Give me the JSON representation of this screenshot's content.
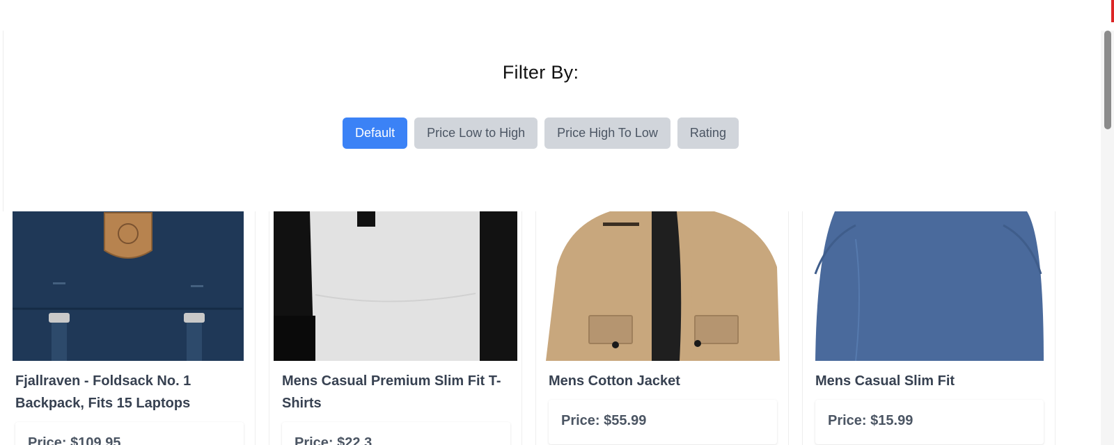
{
  "filter": {
    "title": "Filter By:",
    "options": [
      "Default",
      "Price Low to High",
      "Price High To Low",
      "Rating"
    ],
    "active": "Default"
  },
  "products": [
    {
      "title": "Fjallraven - Foldsack No. 1 Backpack, Fits 15 Laptops",
      "price_label": "Price: $109.95"
    },
    {
      "title": "Mens Casual Premium Slim Fit T-Shirts",
      "price_label": "Price: $22.3"
    },
    {
      "title": "Mens Cotton Jacket",
      "price_label": "Price: $55.99"
    },
    {
      "title": "Mens Casual Slim Fit",
      "price_label": "Price: $15.99"
    }
  ],
  "colors": {
    "accent": "#3b82f6",
    "button_inactive": "#d1d5db",
    "scroll_indicator": "#dc2626"
  }
}
